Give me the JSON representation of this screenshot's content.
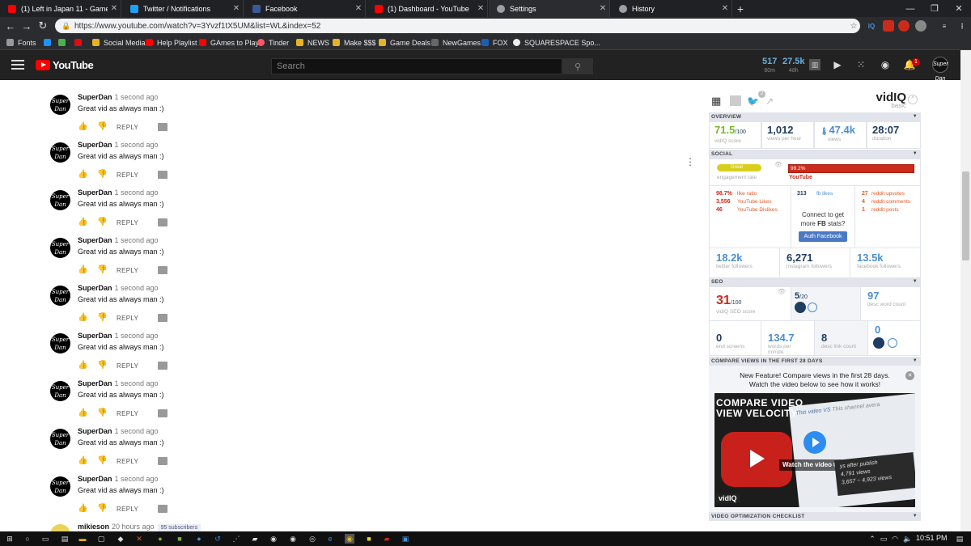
{
  "browser": {
    "tabs": [
      {
        "title": "(1) Left in Japan 11 - Game Sack",
        "color": "#ff0000",
        "active": false
      },
      {
        "title": "Twitter / Notifications",
        "color": "#1da1f2",
        "active": false
      },
      {
        "title": "Facebook",
        "color": "#3b5998",
        "active": false
      },
      {
        "title": "(1) Dashboard - YouTube",
        "color": "#ff0000",
        "active": false
      },
      {
        "title": "Settings",
        "color": "#9aa0a6",
        "active": true
      },
      {
        "title": "History",
        "color": "#9aa0a6",
        "active": false
      }
    ],
    "url": "https://www.youtube.com/watch?v=3Yvzf1tX5UM&list=WL&index=52",
    "bookmarks": [
      {
        "label": "Fonts",
        "color": "#999"
      },
      {
        "label": "",
        "color": "#1e90ff"
      },
      {
        "label": "",
        "color": "#4caf50"
      },
      {
        "label": "",
        "color": "#e50914"
      },
      {
        "label": "Social Media",
        "color": "#e6b422"
      },
      {
        "label": "Help Playlist",
        "color": "#ff0000"
      },
      {
        "label": "GAmes to Play",
        "color": "#ff0000"
      },
      {
        "label": "Tinder",
        "color": "#ff5864"
      },
      {
        "label": "NEWS",
        "color": "#e6b422"
      },
      {
        "label": "Make $$$",
        "color": "#e6b422"
      },
      {
        "label": "Game Deals",
        "color": "#e6b422"
      },
      {
        "label": "NewGames",
        "color": "#666"
      },
      {
        "label": "FOX",
        "color": "#1a5fb4"
      },
      {
        "label": "SQUARESPACE Spo...",
        "color": "#eee"
      }
    ]
  },
  "youtube": {
    "logo": "YouTube",
    "search_placeholder": "Search",
    "header_stats": [
      {
        "value": "517",
        "label": "60m"
      },
      {
        "value": "27.5k",
        "label": "48h"
      }
    ],
    "notification_count": "1",
    "avatar_text": "Super Dan"
  },
  "comments": [
    {
      "author": "SuperDan",
      "time": "1 second ago",
      "text": "Great vid as always man :)",
      "reply": "REPLY"
    },
    {
      "author": "SuperDan",
      "time": "1 second ago",
      "text": "Great vid as always man :)",
      "reply": "REPLY"
    },
    {
      "author": "SuperDan",
      "time": "1 second ago",
      "text": "Great vid as always man :)",
      "reply": "REPLY"
    },
    {
      "author": "SuperDan",
      "time": "1 second ago",
      "text": "Great vid as always man :)",
      "reply": "REPLY"
    },
    {
      "author": "SuperDan",
      "time": "1 second ago",
      "text": "Great vid as always man :)",
      "reply": "REPLY"
    },
    {
      "author": "SuperDan",
      "time": "1 second ago",
      "text": "Great vid as always man :)",
      "reply": "REPLY"
    },
    {
      "author": "SuperDan",
      "time": "1 second ago",
      "text": "Great vid as always man :)",
      "reply": "REPLY"
    },
    {
      "author": "SuperDan",
      "time": "1 second ago",
      "text": "Great vid as always man :)",
      "reply": "REPLY"
    },
    {
      "author": "SuperDan",
      "time": "1 second ago",
      "text": "Great vid as always man :)",
      "reply": "REPLY"
    }
  ],
  "last_comment": {
    "author": "mikieson",
    "time": "20 hours ago",
    "subscribers": "95 subscribers"
  },
  "vidiq": {
    "logo": "vidIQ",
    "plan": "basic",
    "twitter_badge": "2",
    "overview": {
      "title": "OVERVIEW",
      "score": "71.5",
      "score_unit": "/100",
      "score_label": "vidIQ score",
      "vph": "1,012",
      "vph_label": "views per hour",
      "views": "47.4k",
      "views_label": "views",
      "duration": "28:07",
      "duration_label": "duration"
    },
    "social": {
      "title": "SOCIAL",
      "engagement_badge": "Great",
      "engagement_label": "engagement rate",
      "youtube_pct": "99.2%",
      "youtube_label": "YouTube",
      "like_ratio": "98.7%",
      "like_ratio_label": "like ratio",
      "likes": "3,556",
      "likes_label": "YouTube Likes",
      "dislikes": "46",
      "dislikes_label": "YouTube Dislikes",
      "fb_likes": "313",
      "fb_likes_label": "fb likes",
      "fb_connect": "Connect to get more FB stats?",
      "fb_connect_line1": "Connect to get",
      "fb_connect_more": "more",
      "fb_connect_fb": "FB",
      "fb_connect_stats": "stats?",
      "auth_button": "Auth Facebook",
      "reddit_upvotes": "27",
      "reddit_upvotes_label": "reddit upvotes",
      "reddit_comments": "4",
      "reddit_comments_label": "reddit comments",
      "reddit_posts": "1",
      "reddit_posts_label": "reddit posts",
      "twitter_followers": "18.2k",
      "twitter_followers_label": "twitter followers",
      "instagram_followers": "6,271",
      "instagram_followers_label": "instagram followers",
      "facebook_followers": "13.5k",
      "facebook_followers_label": "facebook followers"
    },
    "seo": {
      "title": "SEO",
      "score": "31",
      "score_unit": "/100",
      "score_label": "vidIQ SEO score",
      "tags": "5",
      "tags_unit": "/20",
      "desc_words": "97",
      "desc_words_label": "desc word count",
      "end_screens": "0",
      "end_screens_label": "end screens",
      "wpm": "134.7",
      "wpm_label": "words per minute",
      "desc_links": "8",
      "desc_links_label": "desc link count",
      "cards": "0"
    },
    "compare": {
      "title": "COMPARE VIEWS IN THE FIRST 28 DAYS",
      "headline": "New Feature! Compare views in the first 28 days. Watch the video below to see how it works!",
      "headline_line1": "New Feature! Compare views in the first 28 days.",
      "headline_line2": "Watch the video below to see how it works!",
      "video_title_1": "COMPARE VIDEO",
      "video_title_2": "VIEW VELOCITY",
      "watch_label": "Watch the video",
      "this_video": "This video",
      "vs": "VS",
      "this_channel": "This channel avera",
      "days_after": "ys after publish",
      "views_a": "4,791 views",
      "views_b": "3,657 ~ 4,923 views",
      "video_logo": "vidIQ"
    },
    "checklist": {
      "title": "VIDEO OPTIMIZATION CHECKLIST"
    }
  },
  "taskbar": {
    "time": "10:51 PM"
  }
}
